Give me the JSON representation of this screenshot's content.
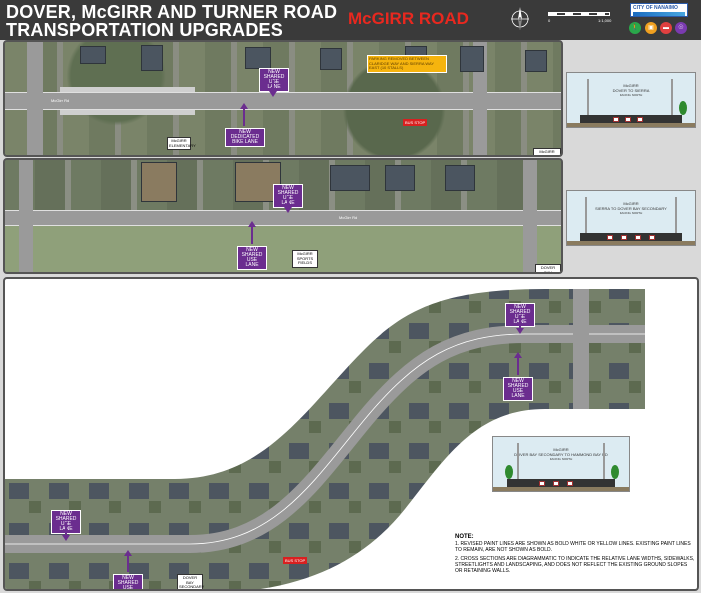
{
  "header": {
    "title_line1": "DOVER, McGIRR AND TURNER ROAD",
    "title_line2": "TRANSPORTATION UPGRADES",
    "road_name": "McGIRR ROAD",
    "city": "CITY OF NANAIMO",
    "scale_left": "0",
    "scale_right": "1:1,000",
    "modes": [
      "pedestrian-icon",
      "transit-icon",
      "car-icon",
      "bike-icon"
    ],
    "colors": {
      "header_bg": "#3a3a3a",
      "road_name": "#e8281f",
      "label_purple": "#6b2d8f",
      "label_yellow": "#f5b40e"
    }
  },
  "panel1": {
    "labels": {
      "shared_top": "NEW SHARED USE LANE",
      "dedicated_bike": "NEW DEDICATED BIKE LANE",
      "parking_note": "PARKING REMOVED BETWEEN CLARIDGE WAY AND SIERRA WAY EAST (10 STALLS)",
      "bus_stop": "BUS STOP",
      "mcgirr_school": "McGIRR ELEMENTARY",
      "mcgirr_sports": "McGIRR SPORTS FIELDS",
      "street_left": "McGirr Rd"
    },
    "xsec": {
      "title": "McGIRR",
      "subtitle": "DOVER TO SIERRA",
      "dir": "FACING NORTH"
    }
  },
  "panel2": {
    "labels": {
      "shared_top": "NEW SHARED USE LANE",
      "shared_bottom": "NEW SHARED USE LANE",
      "mcgirr_sports": "McGIRR SPORTS FIELDS",
      "dover_bay": "DOVER BAY SECONDARY",
      "street": "McGirr Rd"
    },
    "xsec": {
      "title": "McGIRR",
      "subtitle": "SIERRA TO DOVER BAY SECONDARY",
      "dir": "FACING NORTH"
    }
  },
  "panel3": {
    "labels": {
      "shared_upper": "NEW SHARED USE LANE",
      "shared_mid": "NEW SHARED USE LANE",
      "shared_left": "NEW SHARED USE LANE",
      "shared_bottom": "NEW SHARED USE LANE",
      "dover_bay": "DOVER BAY SECONDARY",
      "bus_stop": "BUS STOP"
    },
    "xsec": {
      "title": "McGIRR",
      "subtitle": "DOVER BAY SECONDARY TO HAMMOND BAY RD",
      "dir": "FACING NORTH"
    }
  },
  "notes": {
    "heading": "NOTE:",
    "note1": "1. REVISED PAINT LINES ARE SHOWN AS BOLD WHITE OR YELLOW LINES. EXISTING PAINT LINES TO REMAIN, ARE NOT SHOWN AS BOLD.",
    "note2": "2. CROSS SECTIONS ARE DIAGRAMMATIC TO INDICATE THE RELATIVE LANE WIDTHS, SIDEWALKS, STREETLIGHTS AND LANDSCAPING, AND DOES NOT REFLECT THE EXISTING GROUND SLOPES OR RETAINING WALLS."
  }
}
